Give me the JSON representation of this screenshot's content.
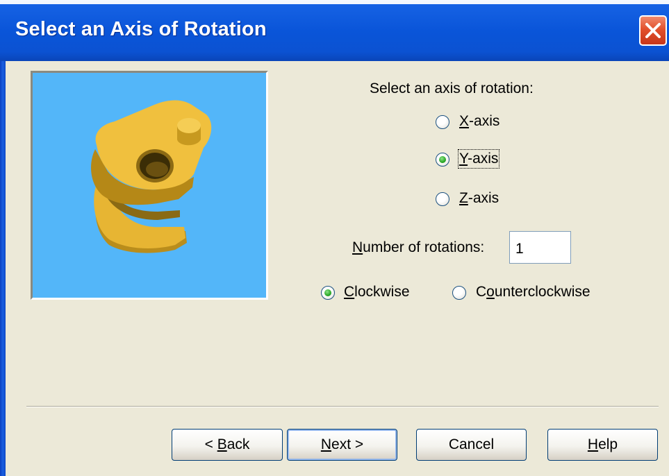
{
  "window": {
    "title": "Select an Axis of Rotation"
  },
  "axis": {
    "prompt": "Select an axis of rotation:",
    "options": [
      {
        "key": "X",
        "rest": "-axis",
        "checked": false
      },
      {
        "key": "Y",
        "rest": "-axis",
        "checked": true
      },
      {
        "key": "Z",
        "rest": "-axis",
        "checked": false
      }
    ]
  },
  "rotations": {
    "label_key": "N",
    "label_rest": "umber of rotations:",
    "value": "1"
  },
  "direction": {
    "clockwise": {
      "key": "C",
      "rest": "lockwise",
      "checked": true
    },
    "counter": {
      "pre": "C",
      "key": "o",
      "rest": "unterclockwise",
      "checked": false
    }
  },
  "buttons": {
    "back": {
      "pre": "< ",
      "key": "B",
      "rest": "ack"
    },
    "next": {
      "key": "N",
      "rest": "ext >"
    },
    "cancel": {
      "label": "Cancel"
    },
    "help": {
      "key": "H",
      "rest": "elp"
    }
  },
  "colors": {
    "titlebar": "#0a55d9",
    "dialog_bg": "#ece9d8",
    "preview_bg": "#53b6f9",
    "part": "#e8b630"
  },
  "icons": {
    "close": "close-icon",
    "preview": "cam-part-3d-model"
  }
}
